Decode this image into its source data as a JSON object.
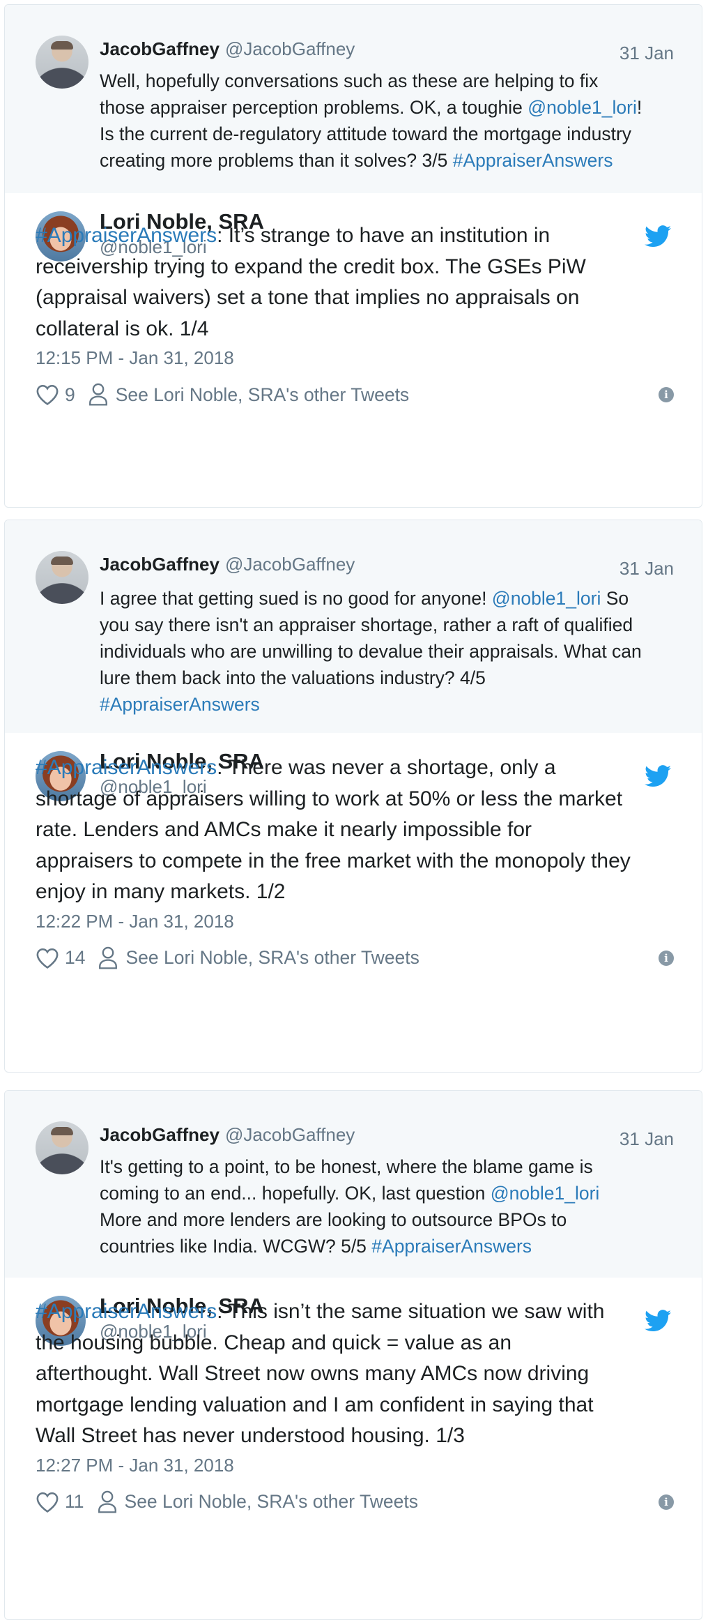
{
  "tweets": [
    {
      "quote": {
        "name": "JacobGaffney",
        "handle": "@JacobGaffney",
        "date": "31 Jan",
        "lines": [
          [
            "Well, hopefully conversations such as these are helping to fix"
          ],
          [
            "those appraiser perception problems. OK, a toughie ",
            "@noble1_lori",
            "!"
          ],
          [
            "Is the current de-regulatory attitude toward the mortgage industry"
          ],
          [
            "creating more problems than it solves? 3/5 ",
            "#AppraiserAnswers"
          ]
        ]
      },
      "author": {
        "name": "Lori Noble, SRA",
        "handle": "@noble1_lori"
      },
      "hashtag": "#AppraiserAnswers",
      "body_lines": [
        ": It’s strange to have an institution in",
        "receivership trying to expand the credit box. The GSEs PiW",
        "(appraisal waivers) set a tone that implies no appraisals on",
        "collateral is ok. 1/4"
      ],
      "time": "12:15 PM - Jan 31, 2018",
      "likes": "9",
      "other_tweets": "See Lori Noble, SRA's other Tweets"
    },
    {
      "quote": {
        "name": "JacobGaffney",
        "handle": "@JacobGaffney",
        "date": "31 Jan",
        "lines": [
          [
            "I agree that getting sued is no good for anyone! ",
            "@noble1_lori",
            " So"
          ],
          [
            "you say there isn't an appraiser shortage, rather a raft of qualified"
          ],
          [
            "individuals who are unwilling to devalue their appraisals. What can"
          ],
          [
            "lure them back into the valuations industry? 4/5"
          ],
          [
            "",
            "#AppraiserAnswers"
          ]
        ]
      },
      "author": {
        "name": "Lori Noble, SRA",
        "handle": "@noble1_lori"
      },
      "hashtag": "#AppraiserAnswers",
      "body_lines": [
        ": There was never a shortage, only a",
        "shortage of appraisers willing to work at 50% or less the market",
        "rate. Lenders and AMCs make it nearly impossible for",
        "appraisers to compete in the free market with the monopoly they",
        "enjoy in many markets. 1/2"
      ],
      "time": "12:22 PM - Jan 31, 2018",
      "likes": "14",
      "other_tweets": "See Lori Noble, SRA's other Tweets"
    },
    {
      "quote": {
        "name": "JacobGaffney",
        "handle": "@JacobGaffney",
        "date": "31 Jan",
        "lines": [
          [
            "It's getting to a point, to be honest, where the blame game is"
          ],
          [
            "coming to an end... hopefully. OK, last question ",
            "@noble1_lori"
          ],
          [
            "More and more lenders are looking to outsource BPOs to"
          ],
          [
            "countries like India. WCGW? 5/5 ",
            "#AppraiserAnswers"
          ]
        ]
      },
      "author": {
        "name": "Lori Noble, SRA",
        "handle": "@noble1_lori"
      },
      "hashtag": "#AppraiserAnswers",
      "body_lines": [
        ": This isn’t the same situation we saw with",
        "the housing bubble. Cheap and quick = value as an",
        "afterthought. Wall Street now owns many AMCs now driving",
        "mortgage lending valuation and I am confident in saying that",
        "Wall Street has never understood housing. 1/3"
      ],
      "time": "12:27 PM - Jan 31, 2018",
      "likes": "11",
      "other_tweets": "See Lori Noble, SRA's other Tweets"
    }
  ]
}
